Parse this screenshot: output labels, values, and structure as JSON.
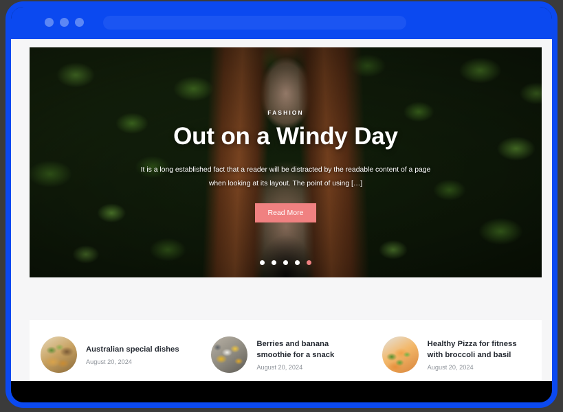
{
  "browser": {
    "traffic_lights": [
      "dot-1",
      "dot-2",
      "dot-3"
    ],
    "url_value": "",
    "url_placeholder": "",
    "chrome_color": "#0b49f0",
    "url_bar_color": "#1b55f2"
  },
  "page": {
    "background": "#f6f6f7"
  },
  "hero": {
    "category": "FASHION",
    "title": "Out on a Windy Day",
    "excerpt": "It is a long established fact that a reader will be distracted by the readable content of a page when looking at its layout. The point of using […]",
    "read_more_label": "Read More",
    "accent_color": "#f08181",
    "slides": [
      {
        "label": "slide-1",
        "active": false
      },
      {
        "label": "slide-2",
        "active": false
      },
      {
        "label": "slide-3",
        "active": false
      },
      {
        "label": "slide-4",
        "active": false
      },
      {
        "label": "slide-5",
        "active": true
      }
    ]
  },
  "recent_posts": [
    {
      "title": "Australian special dishes",
      "date": "August 20, 2024",
      "thumb": "pasta-dish-thumbnail"
    },
    {
      "title": "Berries and banana smoothie for a snack",
      "date": "August 20, 2024",
      "thumb": "breakfast-table-thumbnail"
    },
    {
      "title": "Healthy Pizza for fitness with broccoli and basil",
      "date": "August 20, 2024",
      "thumb": "pizza-thumbnail"
    }
  ]
}
